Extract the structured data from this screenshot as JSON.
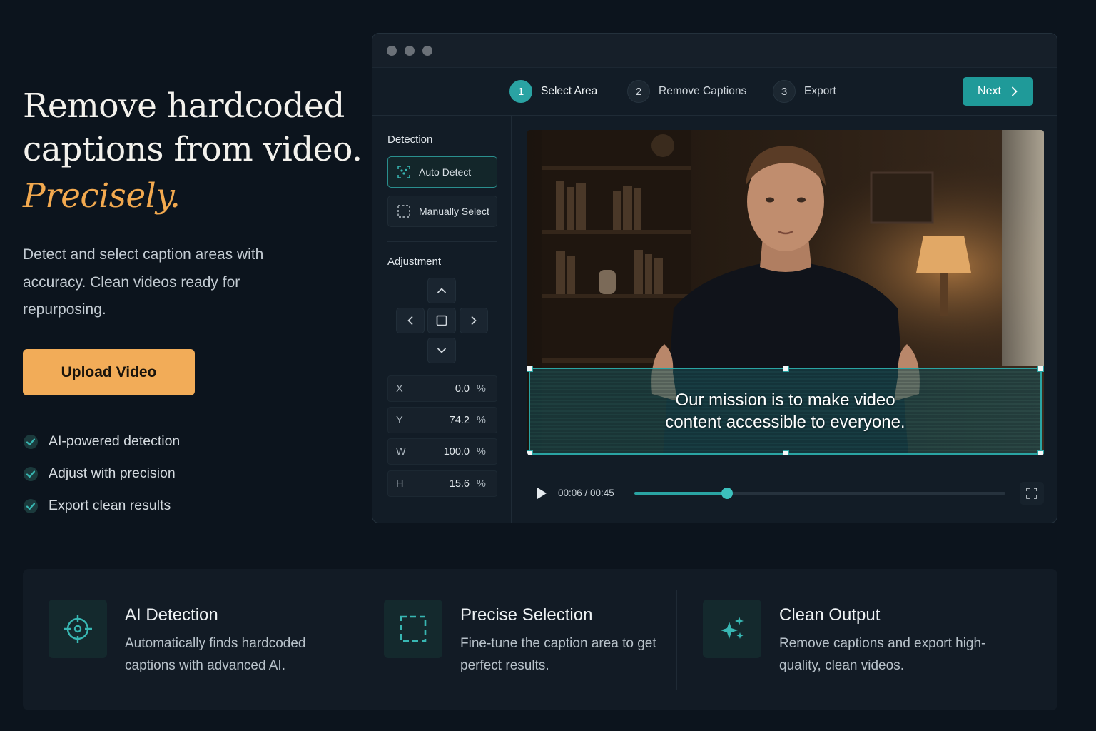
{
  "hero": {
    "title_line1": "Remove hardcoded",
    "title_line2": "captions from video.",
    "accent": "Precisely.",
    "subtitle": "Detect and select caption areas with accuracy. Clean videos ready for repurposing.",
    "upload_label": "Upload Video",
    "checks": [
      "AI-powered detection",
      "Adjust with precision",
      "Export clean results"
    ]
  },
  "steps": [
    {
      "num": "1",
      "label": "Select Area",
      "active": true
    },
    {
      "num": "2",
      "label": "Remove Captions",
      "active": false
    },
    {
      "num": "3",
      "label": "Export",
      "active": false
    }
  ],
  "next_label": "Next",
  "sidebar": {
    "detection_title": "Detection",
    "auto_detect": "Auto Detect",
    "manual_select": "Manually Select",
    "adjustment_title": "Adjustment",
    "fields": [
      {
        "label": "X",
        "value": "0.0",
        "unit": "%"
      },
      {
        "label": "Y",
        "value": "74.2",
        "unit": "%"
      },
      {
        "label": "W",
        "value": "100.0",
        "unit": "%"
      },
      {
        "label": "H",
        "value": "15.6",
        "unit": "%"
      }
    ]
  },
  "video": {
    "caption_line1": "Our mission is to make video",
    "caption_line2": "content accessible to everyone.",
    "time": "00:06 / 00:45",
    "progress": 0.25
  },
  "features": [
    {
      "title": "AI Detection",
      "desc": "Automatically finds hardcoded captions with advanced AI.",
      "icon": "crosshair-icon"
    },
    {
      "title": "Precise Selection",
      "desc": "Fine-tune the caption area to get perfect results.",
      "icon": "dashed-square-icon"
    },
    {
      "title": "Clean Output",
      "desc": "Remove captions and export high-quality, clean videos.",
      "icon": "sparkle-icon"
    }
  ],
  "colors": {
    "accent": "#f2ac58",
    "teal": "#2aa4a3",
    "background": "#0c141d"
  }
}
